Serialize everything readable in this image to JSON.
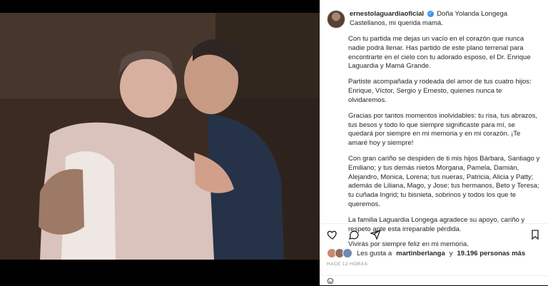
{
  "post": {
    "username": "ernestolaguardiaoficial",
    "caption_lead": "Doña Yolanda Longega Castellanos, mi querida mamá.",
    "paragraphs": [
      "Con tu partida me dejas un vacío en el corazón que nunca nadie podrá llenar. Has partido de este plano terrenal para encontrarte en el cielo con tu adorado esposo, el Dr. Enrique Laguardia y Mamá Grande.",
      "Partiste acompañada y rodeada del amor de tus cuatro hijos: Enrique, Víctor, Sergio y Ernesto, quienes nunca te olvidaremos.",
      "Gracias por tantos momentos inolvidables: tu risa, tus abrazos, tus besos y todo lo que siempre significaste para mí, se quedará por siempre en mi memoria y en mi corazón. ¡Te amaré hoy y siempre!",
      "Con gran cariño se despiden de ti mis hijos Bárbara, Santiago y Emiliano; y tus demás nietos Morgana, Pamela, Damián, Alejandro, Monica, Lorena; tus nueras, Patricia, Alicia y Patty; además de Liliana, Mago, y Jose; tus hermanos, Beto y Teresa; tu cuñada Ingrid; tu bisnieta, sobrinos y todos los que te queremos.",
      "La familia Laguardia Longega agradece su apoyo, cariño y respeto ante esta irreparable pérdida.",
      "Vivirás por siempre feliz en mi memoria."
    ],
    "likes_prefix": "Les gusta a",
    "liker": "martinberlanga",
    "likes_connector": "y",
    "likes_count": "19.196 personas más",
    "timestamp": "HACE 12 HORAS"
  },
  "icons": {
    "like": "heart-icon",
    "comment": "comment-icon",
    "share": "share-icon",
    "save": "bookmark-icon",
    "emoji": "emoji-icon"
  }
}
